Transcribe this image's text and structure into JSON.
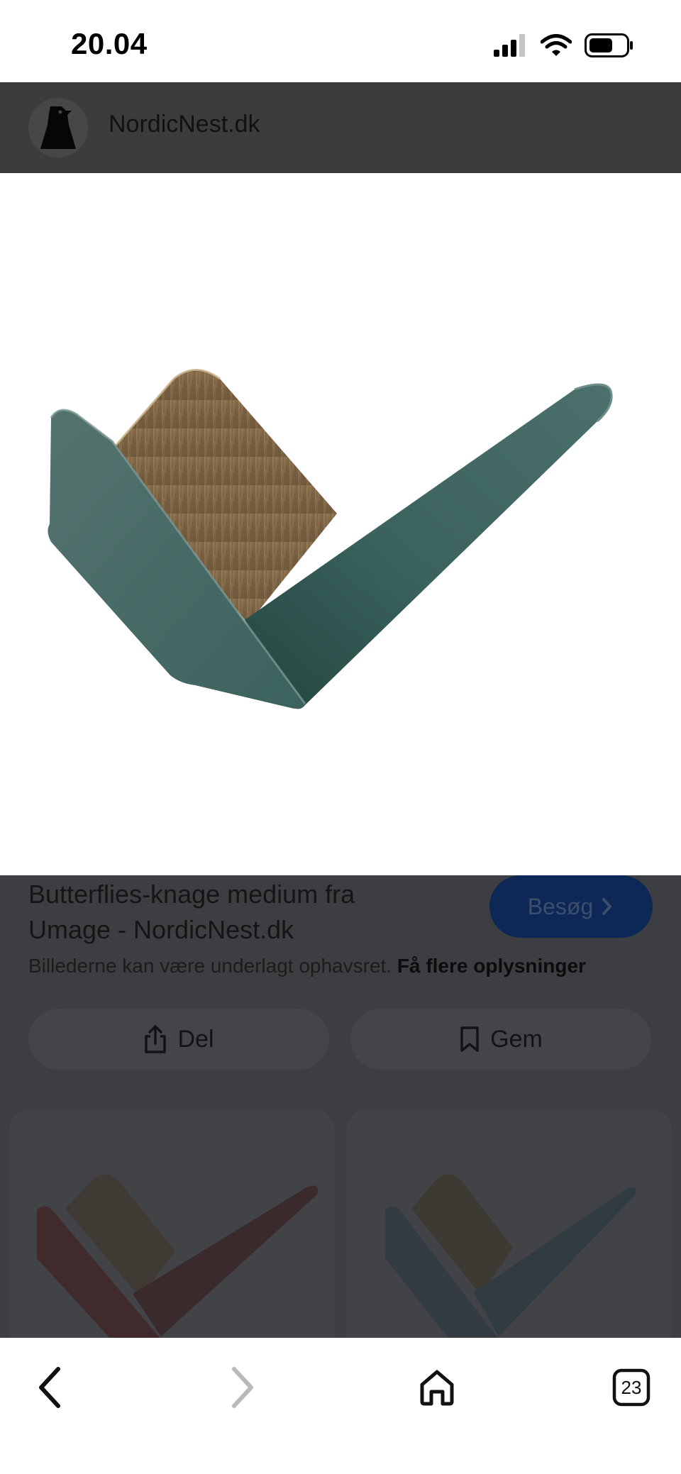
{
  "status_bar": {
    "time": "20.04",
    "icons": [
      "cellular-signal-icon",
      "wifi-icon",
      "battery-icon"
    ]
  },
  "site_header": {
    "logo_icon": "nordic-nest-logo-icon",
    "site_name": "NordicNest.dk"
  },
  "hero": {
    "image": "butterflies-hook-green"
  },
  "result": {
    "title": "Butterflies-knage medium fra Umage - NordicNest.dk",
    "visit_label": "Besøg",
    "visit_icon": "chevron-right-icon",
    "copyright_text": "Billederne kan være underlagt ophavsret.",
    "copyright_more": "Få flere oplysninger"
  },
  "actions": {
    "share_label": "Del",
    "share_icon": "share-icon",
    "save_label": "Gem",
    "save_icon": "bookmark-icon"
  },
  "related": {
    "items": [
      "butterflies-hook-red",
      "butterflies-hook-dark-blue"
    ]
  },
  "bottom_nav": {
    "back_icon": "back-arrow-icon",
    "forward_icon": "forward-arrow-icon",
    "home_icon": "home-icon",
    "tabs_count": "23"
  },
  "colors": {
    "header_bg": "#3c3c3c",
    "overlay_bg": "#3d3e42",
    "visit_button_bg": "#0d2857",
    "product_green": "#3a6460"
  }
}
